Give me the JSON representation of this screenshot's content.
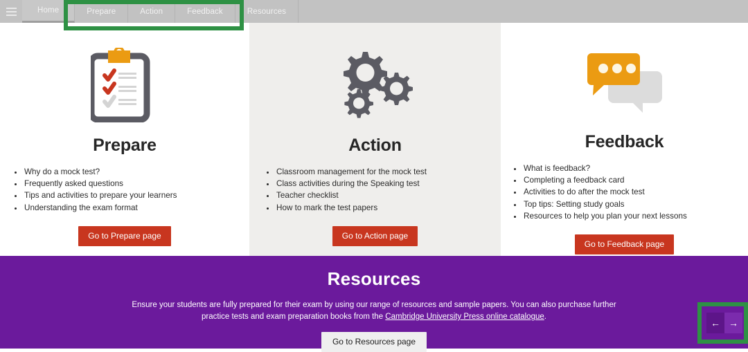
{
  "topbar": {
    "menu_icon": "hamburger-menu-icon",
    "items": [
      {
        "label": "Home",
        "active": true
      },
      {
        "label": "Prepare",
        "active": false
      },
      {
        "label": "Action",
        "active": false
      },
      {
        "label": "Feedback",
        "active": false
      },
      {
        "label": "Resources",
        "active": false
      }
    ]
  },
  "columns": {
    "prepare": {
      "icon": "clipboard-checklist-icon",
      "title": "Prepare",
      "bullets": [
        "Why do a mock test?",
        "Frequently asked questions",
        "Tips and activities to prepare your learners",
        "Understanding the exam format"
      ],
      "button": "Go to Prepare page"
    },
    "action": {
      "icon": "gears-icon",
      "title": "Action",
      "bullets": [
        "Classroom management for the mock test",
        "Class activities during the Speaking test",
        "Teacher checklist",
        "How to mark the test papers"
      ],
      "button": "Go to Action page"
    },
    "feedback": {
      "icon": "speech-bubbles-icon",
      "title": "Feedback",
      "bullets": [
        "What is feedback?",
        "Completing a feedback card",
        "Activities to do after the mock test",
        "Top tips: Setting study goals",
        "Resources to help you plan your next lessons"
      ],
      "button": "Go to Feedback page"
    }
  },
  "resources": {
    "title": "Resources",
    "text_before_link": "Ensure your students are fully prepared for their exam by using our range of resources and sample papers. You can also purchase further practice tests and exam preparation books from the ",
    "link_text": "Cambridge University Press online catalogue",
    "text_after_link": ".",
    "button": "Go to Resources page",
    "prev_arrow": "←",
    "next_arrow": "→"
  },
  "colors": {
    "topbar": "#c2c2c2",
    "column_alt_bg": "#efeeec",
    "button_red": "#c8361f",
    "resources_purple": "#6b1a9c",
    "annotation_green": "#2e9144",
    "icon_gray": "#5b5b63",
    "icon_orange": "#eb9b12",
    "icon_check_red": "#c8361f"
  }
}
